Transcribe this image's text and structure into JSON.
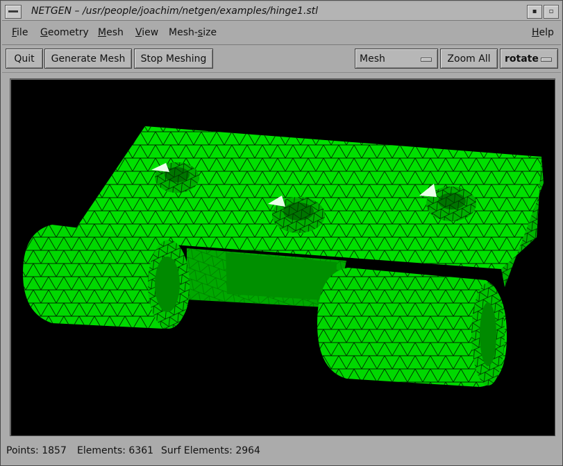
{
  "window": {
    "title": "NETGEN – /usr/people/joachim/netgen/examples/hinge1.stl"
  },
  "menu": {
    "file": {
      "label": "File",
      "mnemonic": "F",
      "rest": "ile"
    },
    "geometry": {
      "label": "Geometry",
      "mnemonic": "G",
      "rest": "eometry"
    },
    "mesh": {
      "label": "Mesh",
      "mnemonic": "M",
      "rest": "esh"
    },
    "view": {
      "label": "View",
      "mnemonic": "V",
      "rest": "iew"
    },
    "meshsize": {
      "label": "Mesh-size",
      "before": "Mesh-",
      "mnemonic": "s",
      "rest": "ize"
    },
    "help": {
      "label": "Help",
      "mnemonic": "H",
      "rest": "elp"
    }
  },
  "toolbar": {
    "quit": "Quit",
    "generate": "Generate Mesh",
    "stop": "Stop Meshing",
    "view_select": "Mesh",
    "zoom_all": "Zoom All",
    "mode_select": "rotate"
  },
  "status": {
    "points": "Points: 1857",
    "elements": "Elements: 6361",
    "surf_elements": "Surf Elements: 2964"
  },
  "colors": {
    "background": "#000000",
    "mesh_fill": "#00e600",
    "mesh_shade": "#00b400",
    "mesh_edges": "#002a00"
  }
}
